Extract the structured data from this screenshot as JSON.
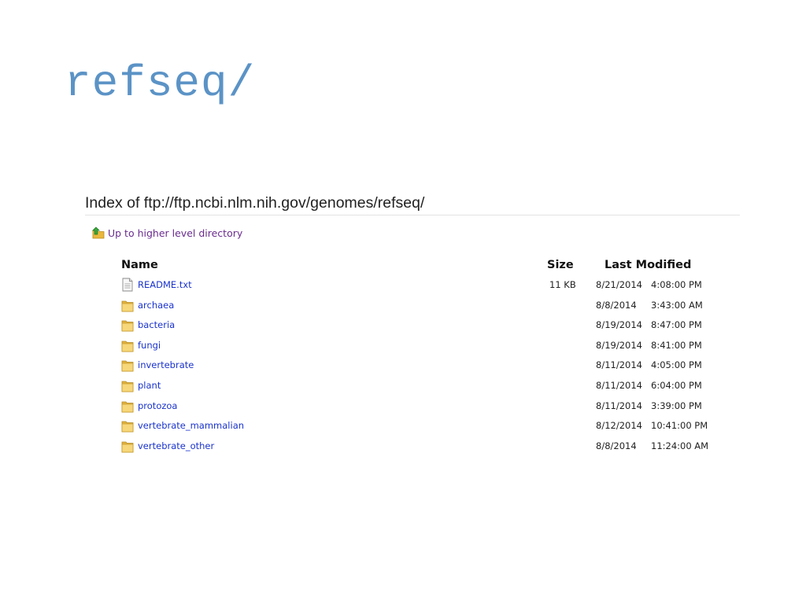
{
  "slide": {
    "title": "refseq/"
  },
  "listing": {
    "heading": "Index of ftp://ftp.ncbi.nlm.nih.gov/genomes/refseq/",
    "up_link": "Up to higher level directory",
    "columns": {
      "name": "Name",
      "size": "Size",
      "modified": "Last Modified"
    },
    "entries": [
      {
        "name": "README.txt",
        "type": "file",
        "icon": "text-file-icon",
        "size": "11 KB",
        "date": "8/21/2014",
        "time": "4:08:00 PM"
      },
      {
        "name": "archaea",
        "type": "folder",
        "icon": "folder-icon",
        "size": "",
        "date": "8/8/2014",
        "time": "3:43:00 AM"
      },
      {
        "name": "bacteria",
        "type": "folder",
        "icon": "folder-icon",
        "size": "",
        "date": "8/19/2014",
        "time": "8:47:00 PM"
      },
      {
        "name": "fungi",
        "type": "folder",
        "icon": "folder-icon",
        "size": "",
        "date": "8/19/2014",
        "time": "8:41:00 PM"
      },
      {
        "name": "invertebrate",
        "type": "folder",
        "icon": "folder-icon",
        "size": "",
        "date": "8/11/2014",
        "time": "4:05:00 PM"
      },
      {
        "name": "plant",
        "type": "folder",
        "icon": "folder-icon",
        "size": "",
        "date": "8/11/2014",
        "time": "6:04:00 PM"
      },
      {
        "name": "protozoa",
        "type": "folder",
        "icon": "folder-icon",
        "size": "",
        "date": "8/11/2014",
        "time": "3:39:00 PM"
      },
      {
        "name": "vertebrate_mammalian",
        "type": "folder",
        "icon": "folder-icon",
        "size": "",
        "date": "8/12/2014",
        "time": "10:41:00 PM"
      },
      {
        "name": "vertebrate_other",
        "type": "folder",
        "icon": "folder-icon",
        "size": "",
        "date": "8/8/2014",
        "time": "11:24:00 AM"
      }
    ]
  },
  "colors": {
    "title": "#5b93c6",
    "link": "#1a33cc",
    "visited_link": "#6a2c8e",
    "folder": "#f2c94c"
  }
}
